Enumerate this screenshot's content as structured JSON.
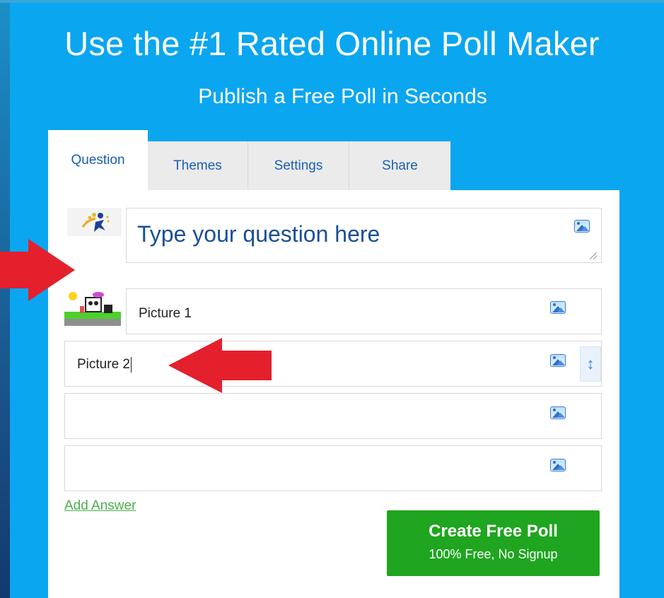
{
  "headline": "Use the #1 Rated Online Poll Maker",
  "subhead": "Publish a Free Poll in Seconds",
  "tabs": [
    {
      "label": "Question",
      "active": true
    },
    {
      "label": "Themes",
      "active": false
    },
    {
      "label": "Settings",
      "active": false
    },
    {
      "label": "Share",
      "active": false
    }
  ],
  "question": {
    "placeholder": "Type your question here",
    "value": ""
  },
  "answers": [
    {
      "value": "Picture 1"
    },
    {
      "value": "Picture 2"
    },
    {
      "value": ""
    },
    {
      "value": ""
    }
  ],
  "add_answer_label": "Add Answer",
  "create_button": {
    "label": "Create Free Poll",
    "sublabel": "100% Free, No Signup"
  },
  "colors": {
    "background": "#0aa6f0",
    "tab_text": "#1a5fb4",
    "create_button": "#1fa51f",
    "add_answer": "#4cae4c",
    "annotation_arrow": "#e3202b"
  },
  "icons": [
    "image-upload-icon",
    "drag-handle-icon"
  ]
}
